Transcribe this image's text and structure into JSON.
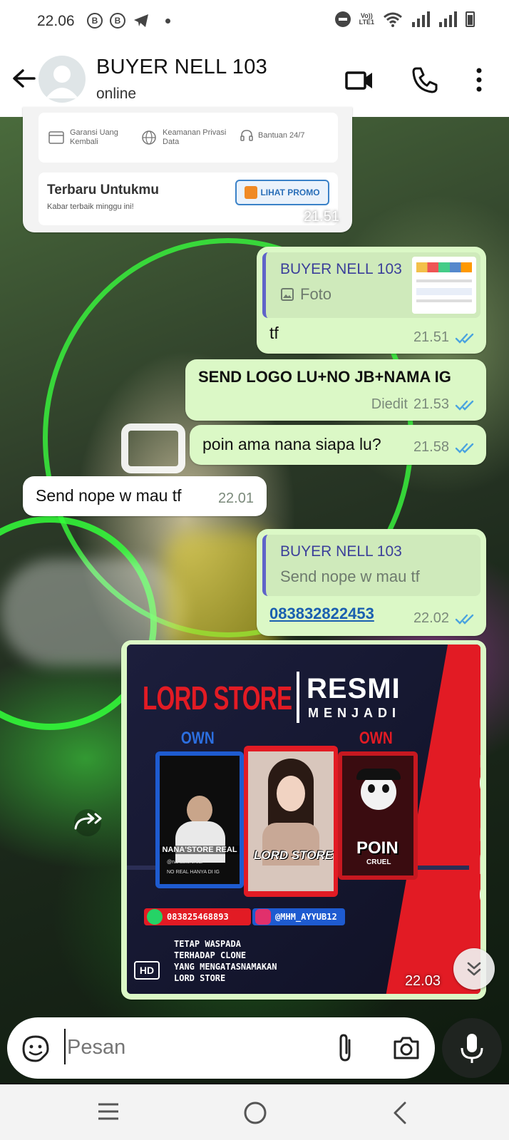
{
  "status_bar": {
    "time": "22.06",
    "left_icons": [
      "b-icon",
      "b-icon",
      "telegram-icon",
      "dot-icon"
    ],
    "volte_line1": "Vo))",
    "volte_line2": "LTE1"
  },
  "header": {
    "contact_name": "BUYER NELL 103",
    "status": "online"
  },
  "promo_card": {
    "features": [
      "Garansi Uang Kembali",
      "Keamanan Privasi Data",
      "Bantuan 24/7"
    ],
    "title": "Terbaru Untukmu",
    "subtitle": "Kabar terbaik minggu ini!",
    "button": "LIHAT PROMO",
    "time": "21.51"
  },
  "messages": [
    {
      "dir": "out",
      "quote_name": "BUYER NELL 103",
      "quote_text": "Foto",
      "text": "tf",
      "time": "21.51",
      "read": true
    },
    {
      "dir": "out",
      "text": "SEND LOGO LU+NO JB+NAMA IG",
      "edited": "Diedit",
      "time": "21.53",
      "read": true
    },
    {
      "dir": "out",
      "text": "poin ama nana siapa lu?",
      "time": "21.58",
      "read": true
    },
    {
      "dir": "in",
      "text": "Send nope w mau tf",
      "time": "22.01"
    },
    {
      "dir": "out",
      "quote_name": "BUYER NELL 103",
      "quote_text": "Send nope w mau tf",
      "text": "083832822453",
      "time": "22.02",
      "read": true
    }
  ],
  "image_message": {
    "time": "22.03",
    "hd_badge": "HD",
    "poster": {
      "brand": "LORD STORE",
      "headline": "RESMI",
      "subheadline": "MENJADI",
      "own_label": "OWN",
      "card_left": "NANA'STORE REAL",
      "card_left_small": "@nanastorereal",
      "card_left_bottom": "NO REAL HANYA DI IG",
      "card_mid": "LORD STORE",
      "card_right": "POIN",
      "card_right_sub": "CRUEL",
      "phone": "083825468893",
      "instagram": "@MHM_AYYUB12",
      "warning": [
        "TETAP WASPADA",
        "TERHADAP CLONE",
        "YANG MENGATASNAMAKAN",
        "LORD STORE"
      ],
      "side_text": "LORD STORE"
    }
  },
  "input": {
    "placeholder": "Pesan"
  },
  "colors": {
    "outgoing": "#dbf8c6",
    "incoming": "#ffffff",
    "tick_read": "#4aa3df",
    "accent_green": "#32ff3a",
    "poster_red": "#e21b24"
  }
}
